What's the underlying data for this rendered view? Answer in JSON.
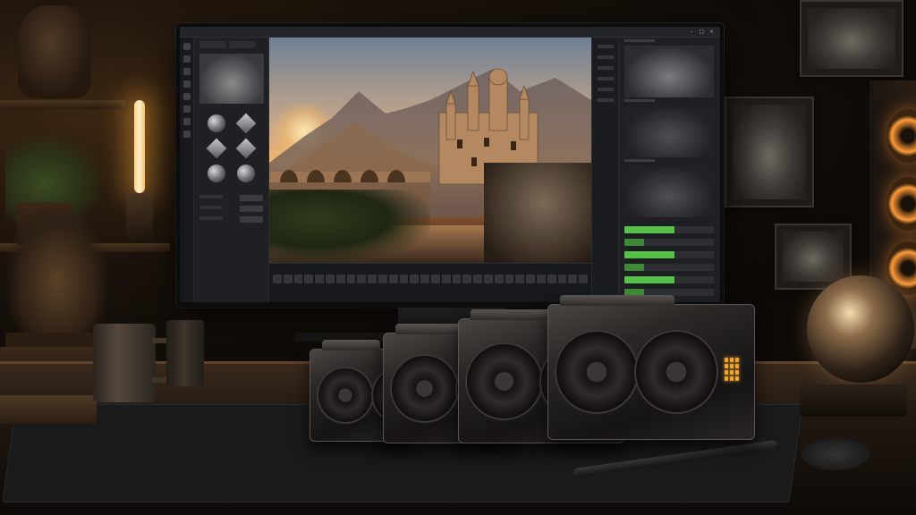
{
  "scene": {
    "description_label": "",
    "accent_colors": {
      "green": "#57c24a",
      "amber": "#f0a532",
      "lamp_glow": "#ffc46b",
      "screen_ui": "#1c1d20"
    }
  },
  "monitor": {
    "app": {
      "title": "",
      "window_buttons": [
        "–",
        "□",
        "×"
      ]
    },
    "left_panel": {
      "materials": [
        "sphere",
        "cube",
        "cube",
        "cube",
        "sphere",
        "sphere"
      ]
    },
    "viewport": {
      "subject": "castle-landscape-render"
    },
    "timeline": {
      "label": ""
    },
    "right_panel": {
      "thumbnails": [
        "render-thumb",
        "wireframe-thumb",
        "mesh-thumb"
      ],
      "progress_bars": [
        {
          "fill": 0.56,
          "color": "#57c24a"
        },
        {
          "fill": 0.22,
          "color": "#3d8a35"
        },
        {
          "fill": 0.56,
          "color": "#57c24a"
        },
        {
          "fill": 0.22,
          "color": "#3d8a35"
        },
        {
          "fill": 0.56,
          "color": "#57c24a"
        },
        {
          "fill": 0.22,
          "color": "#3d8a35"
        }
      ]
    }
  },
  "gpus": [
    {
      "name": "gpu-card-1",
      "led_color": "#57c24a",
      "led_count": 12
    },
    {
      "name": "gpu-card-2",
      "led_color": "#57c24a",
      "led_count": 12
    },
    {
      "name": "gpu-card-3",
      "led_color": "#f0a532",
      "led_count": 12
    },
    {
      "name": "gpu-card-4",
      "led_color": "#f0a532",
      "led_count": 12
    }
  ]
}
